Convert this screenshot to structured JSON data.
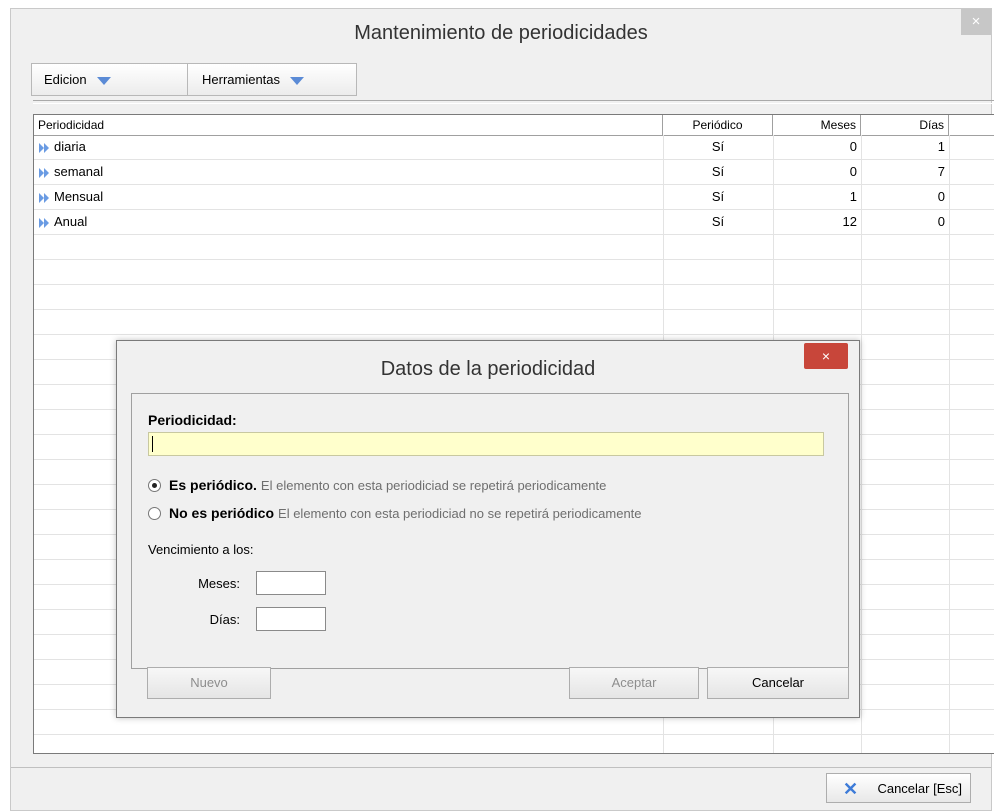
{
  "window": {
    "title": "Mantenimiento de periodicidades",
    "close_label": "×"
  },
  "toolbar": {
    "edicion_label": "Edicion",
    "herramientas_label": "Herramientas"
  },
  "grid": {
    "columns": [
      "Periodicidad",
      "Periódico",
      "Meses",
      "Días"
    ],
    "rows": [
      {
        "name": "diaria",
        "periodico": "Sí",
        "meses": "0",
        "dias": "1"
      },
      {
        "name": "semanal",
        "periodico": "Sí",
        "meses": "0",
        "dias": "7"
      },
      {
        "name": "Mensual",
        "periodico": "Sí",
        "meses": "1",
        "dias": "0"
      },
      {
        "name": "Anual",
        "periodico": "Sí",
        "meses": "12",
        "dias": "0"
      }
    ],
    "row_icon": "double-chevron-right-icon"
  },
  "footer": {
    "cancel_label": "Cancelar [Esc]"
  },
  "dialog": {
    "title": "Datos de la periodicidad",
    "close_label": "×",
    "periodicidad_label": "Periodicidad:",
    "periodicidad_value": "",
    "radio_periodico": {
      "label": "Es periódico.",
      "hint": "El elemento con esta periodiciad se repetirá periodicamente",
      "selected": true
    },
    "radio_no_periodico": {
      "label": "No es periódico",
      "hint": "El elemento con esta periodiciad no se repetirá periodicamente",
      "selected": false
    },
    "vencimiento_label": "Vencimiento a los:",
    "meses_label": "Meses:",
    "meses_value": "",
    "dias_label": "Días:",
    "dias_value": "",
    "nuevo_label": "Nuevo",
    "aceptar_label": "Aceptar",
    "cancelar_label": "Cancelar"
  },
  "colors": {
    "accent": "#5b8bd6",
    "input_bg": "#ffffcc",
    "close_red": "#c8463a"
  }
}
